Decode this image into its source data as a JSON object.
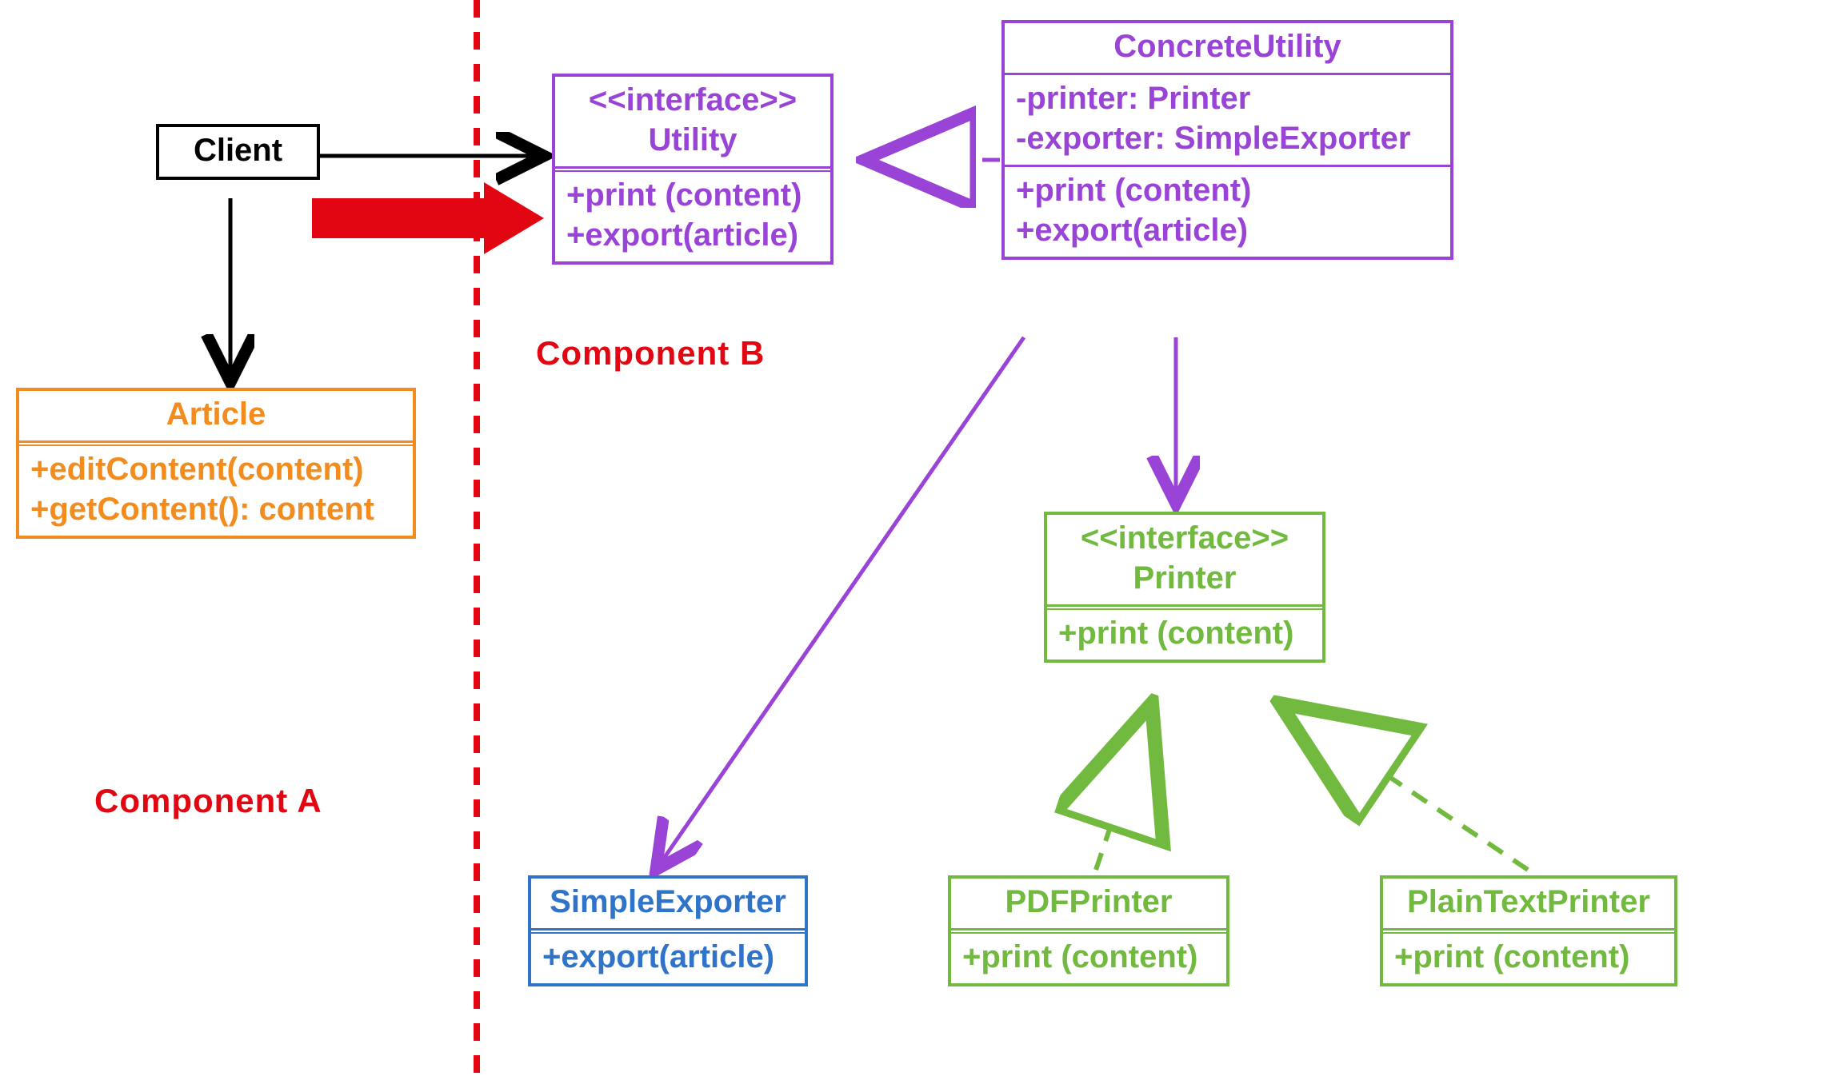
{
  "labels": {
    "componentA": "Component  A",
    "componentB": "Component  B"
  },
  "client": {
    "title": "Client"
  },
  "article": {
    "title": "Article",
    "op1": "+editContent(content)",
    "op2": "+getContent(): content"
  },
  "utility": {
    "stereo": "<<interface>>",
    "title": "Utility",
    "op1": "+print (content)",
    "op2": "+export(article)"
  },
  "concreteUtility": {
    "title": "ConcreteUtility",
    "attr1": "-printer: Printer",
    "attr2": "-exporter: SimpleExporter",
    "op1": "+print (content)",
    "op2": "+export(article)"
  },
  "printer": {
    "stereo": "<<interface>>",
    "title": "Printer",
    "op1": "+print (content)"
  },
  "simpleExporter": {
    "title": "SimpleExporter",
    "op1": "+export(article)"
  },
  "pdfPrinter": {
    "title": "PDFPrinter",
    "op1": "+print (content)"
  },
  "plainTextPrinter": {
    "title": "PlainTextPrinter",
    "op1": "+print (content)"
  },
  "colors": {
    "black": "#000000",
    "orange": "#f28c1e",
    "purple": "#9944d6",
    "green": "#71b93f",
    "blue": "#2f74c9",
    "red": "#e20613"
  }
}
